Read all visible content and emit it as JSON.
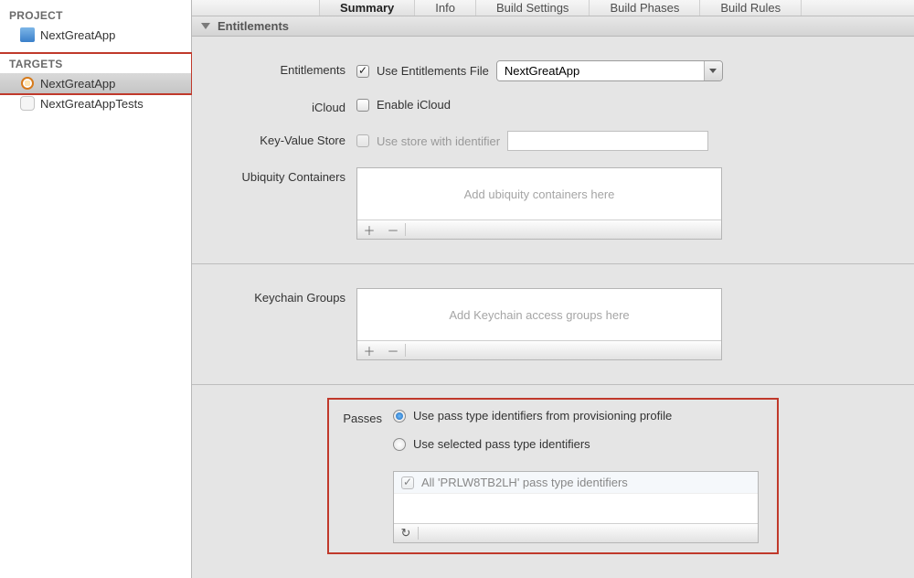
{
  "sidebar": {
    "project_header": "PROJECT",
    "targets_header": "TARGETS",
    "project_name": "NextGreatApp",
    "target_name": "NextGreatApp",
    "tests_name": "NextGreatAppTests"
  },
  "tabs": {
    "summary": "Summary",
    "info": "Info",
    "build_settings": "Build Settings",
    "build_phases": "Build Phases",
    "build_rules": "Build Rules"
  },
  "section": {
    "entitlements": "Entitlements"
  },
  "form": {
    "entitlements_label": "Entitlements",
    "use_entitlements_file": "Use Entitlements File",
    "entitlements_file_value": "NextGreatApp",
    "icloud_label": "iCloud",
    "enable_icloud": "Enable iCloud",
    "kvs_label": "Key-Value Store",
    "kvs_checkbox": "Use store with identifier",
    "ubiquity_label": "Ubiquity Containers",
    "ubiquity_placeholder": "Add ubiquity containers here",
    "keychain_label": "Keychain Groups",
    "keychain_placeholder": "Add Keychain access groups here",
    "passes_label": "Passes",
    "passes_radio1": "Use pass type identifiers from provisioning profile",
    "passes_radio2": "Use selected pass type identifiers",
    "passes_row": "All 'PRLW8TB2LH' pass type identifiers"
  },
  "glyphs": {
    "plus": "＋",
    "minus": "－",
    "refresh": "↻"
  }
}
